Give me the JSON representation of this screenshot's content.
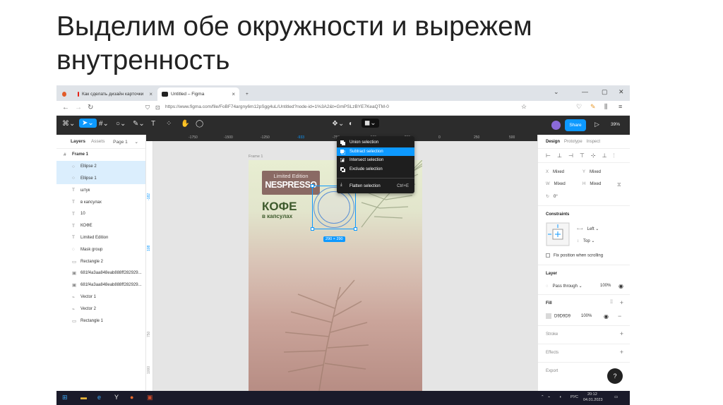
{
  "slide": {
    "title": "Выделим обе окружности и вырежем внутренность"
  },
  "browser": {
    "tabs": [
      {
        "label": ""
      },
      {
        "label": "Как сделать дизайн карточки"
      },
      {
        "label": "Untitled – Figma"
      }
    ],
    "new_tab": "+",
    "url": "https://www.figma.com/file/FoBF74argny6m12pSgg4uL/Untitled?node-id=1%3A2&t=GmPSLzBYE7KeaQTM-0",
    "win_min": "—",
    "win_max": "▢",
    "win_close": "✕"
  },
  "toolbar": {
    "share": "Share",
    "zoom": "39%",
    "play": "▷"
  },
  "layers_panel": {
    "tab_layers": "Layers",
    "tab_assets": "Assets",
    "page": "Page 1",
    "frame": "Frame 1",
    "items": [
      {
        "label": "Ellipse 2",
        "icon": "○",
        "selected": true
      },
      {
        "label": "Ellipse 1",
        "icon": "○",
        "selected": true
      },
      {
        "label": "штук",
        "icon": "T",
        "selected": false
      },
      {
        "label": "в капсулах",
        "icon": "T",
        "selected": false
      },
      {
        "label": "10",
        "icon": "T",
        "selected": false
      },
      {
        "label": "КОФЕ",
        "icon": "T",
        "selected": false
      },
      {
        "label": "Limited Edition",
        "icon": "T",
        "selected": false
      },
      {
        "label": "Mask group",
        "icon": "◌",
        "selected": false
      },
      {
        "label": "Rectangle 2",
        "icon": "▭",
        "selected": false
      },
      {
        "label": "681f4a3aa848eab888ff282929...",
        "icon": "▣",
        "selected": false
      },
      {
        "label": "681f4a3aa848eab888ff282929...",
        "icon": "▣",
        "selected": false
      },
      {
        "label": "Vector 1",
        "icon": "⌁",
        "selected": false
      },
      {
        "label": "Vector 2",
        "icon": "⌁",
        "selected": false
      },
      {
        "label": "Rectangle 1",
        "icon": "▭",
        "selected": false
      }
    ]
  },
  "rulers": {
    "top": [
      "-1750",
      "-1500",
      "-1250",
      "-933",
      "-750",
      "-500",
      "-250",
      "0",
      "250",
      "500"
    ],
    "left": [
      "-182",
      "108",
      "750",
      "1000"
    ]
  },
  "canvas": {
    "frame_label": "Frame 1",
    "badge_line1": "Limited Edition",
    "badge_line2": "NESPRESSO",
    "coffee": "КОФЕ",
    "capsules": "в капсулах",
    "dimension": "290 × 290"
  },
  "boolean_menu": {
    "items": [
      {
        "label": "Union selection",
        "shortcut": ""
      },
      {
        "label": "Subtract selection",
        "shortcut": ""
      },
      {
        "label": "Intersect selection",
        "shortcut": ""
      },
      {
        "label": "Exclude selection",
        "shortcut": ""
      }
    ],
    "flatten": "Flatten selection",
    "flatten_shortcut": "Ctrl+E"
  },
  "design_panel": {
    "tab_design": "Design",
    "tab_prototype": "Prototype",
    "tab_inspect": "Inspect",
    "x_label": "X",
    "x_val": "Mixed",
    "y_label": "Y",
    "y_val": "Mixed",
    "w_label": "W",
    "w_val": "Mixed",
    "h_label": "H",
    "h_val": "Mixed",
    "rot_label": "↻",
    "rot_val": "0°",
    "constraints": "Constraints",
    "c_left": "Left",
    "c_top": "Top",
    "fix_position": "Fix position when scrolling",
    "layer": "Layer",
    "pass_through": "Pass through",
    "layer_opacity": "100%",
    "fill": "Fill",
    "fill_hex": "D9D9D9",
    "fill_opacity": "100%",
    "stroke": "Stroke",
    "effects": "Effects",
    "export": "Export"
  },
  "help": "?",
  "taskbar": {
    "lang": "РУС",
    "time": "20:12",
    "date": "04.01.2023"
  },
  "colors": {
    "accent": "#0d99ff",
    "toolbar_bg": "#2c2c2c",
    "badge": "#8a6a64",
    "green": "#3d5a2c"
  }
}
